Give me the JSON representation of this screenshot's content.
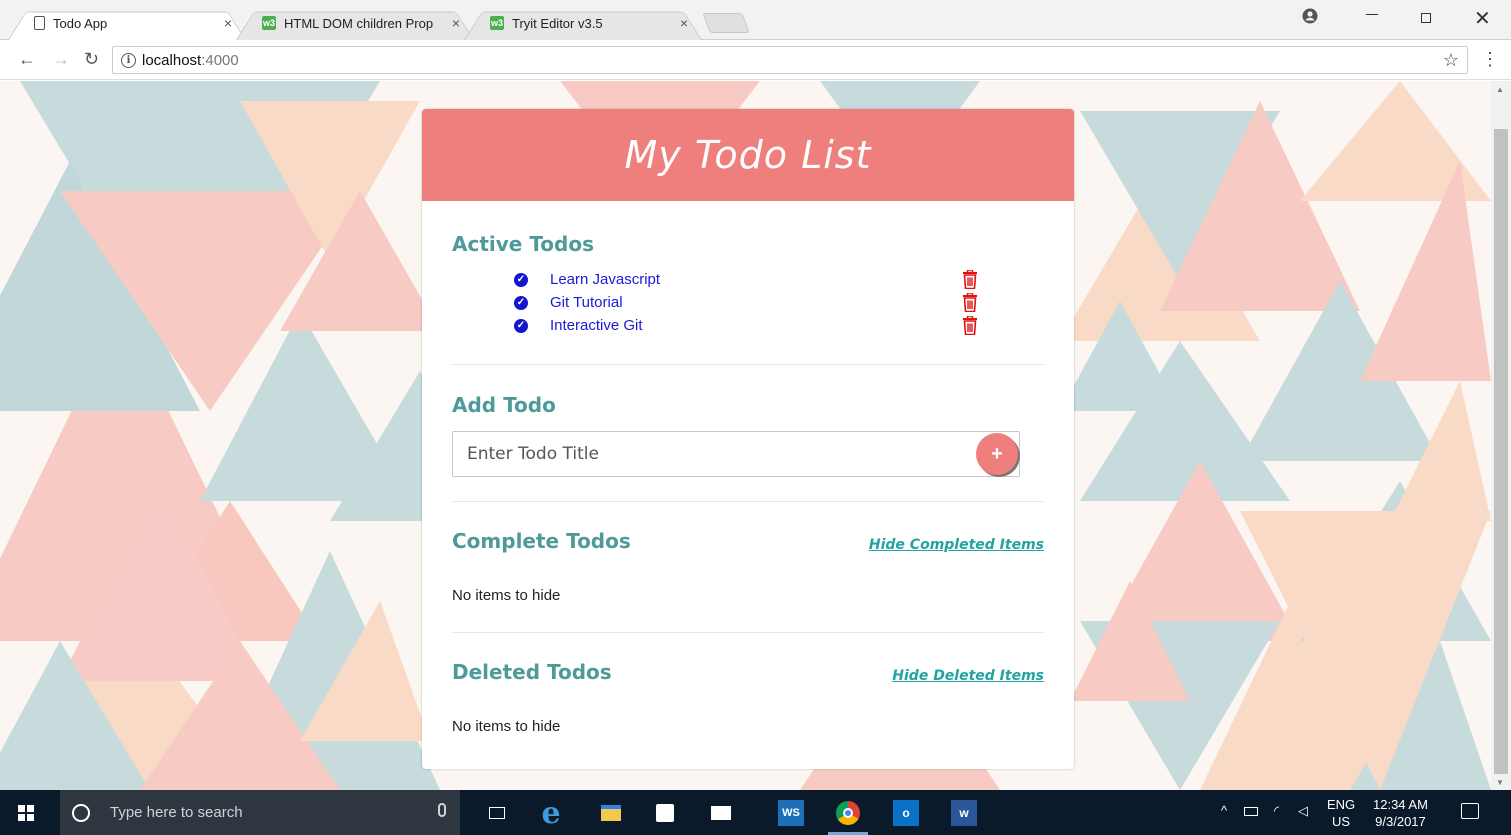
{
  "browser": {
    "tabs": [
      {
        "title": "Todo App",
        "icon": "page-icon",
        "close": "×",
        "active": true
      },
      {
        "title": "HTML DOM children Prop",
        "icon": "w3schools-icon",
        "close": "×",
        "active": false
      },
      {
        "title": "Tryit Editor v3.5",
        "icon": "w3schools-icon",
        "close": "×",
        "active": false
      }
    ],
    "address": {
      "host": "localhost",
      "port": ":4000"
    }
  },
  "app": {
    "title": "My Todo List",
    "active": {
      "heading": "Active Todos",
      "items": [
        {
          "text": "Learn Javascript"
        },
        {
          "text": "Git Tutorial"
        },
        {
          "text": "Interactive Git"
        }
      ]
    },
    "add": {
      "heading": "Add Todo",
      "placeholder": "Enter Todo Title",
      "button_label": "+"
    },
    "complete": {
      "heading": "Complete Todos",
      "toggle_label": "Hide Completed Items",
      "empty_text": "No items to hide"
    },
    "deleted": {
      "heading": "Deleted Todos",
      "toggle_label": "Hide Deleted Items",
      "empty_text": "No items to hide"
    },
    "colors": {
      "header": "#ef7f7d",
      "heading_text": "#4e9a9a",
      "link": "#22a2a2",
      "todo_text": "#1a1ad6",
      "trash": "#e01010"
    }
  },
  "taskbar": {
    "search_placeholder": "Type here to search",
    "lang_primary": "ENG",
    "lang_secondary": "US",
    "time": "12:34 AM",
    "date": "9/3/2017",
    "apps": [
      "task-view-icon",
      "edge-icon",
      "file-explorer-icon",
      "store-icon",
      "mail-icon",
      "webstorm-icon",
      "chrome-icon",
      "outlook-icon",
      "word-icon"
    ]
  }
}
